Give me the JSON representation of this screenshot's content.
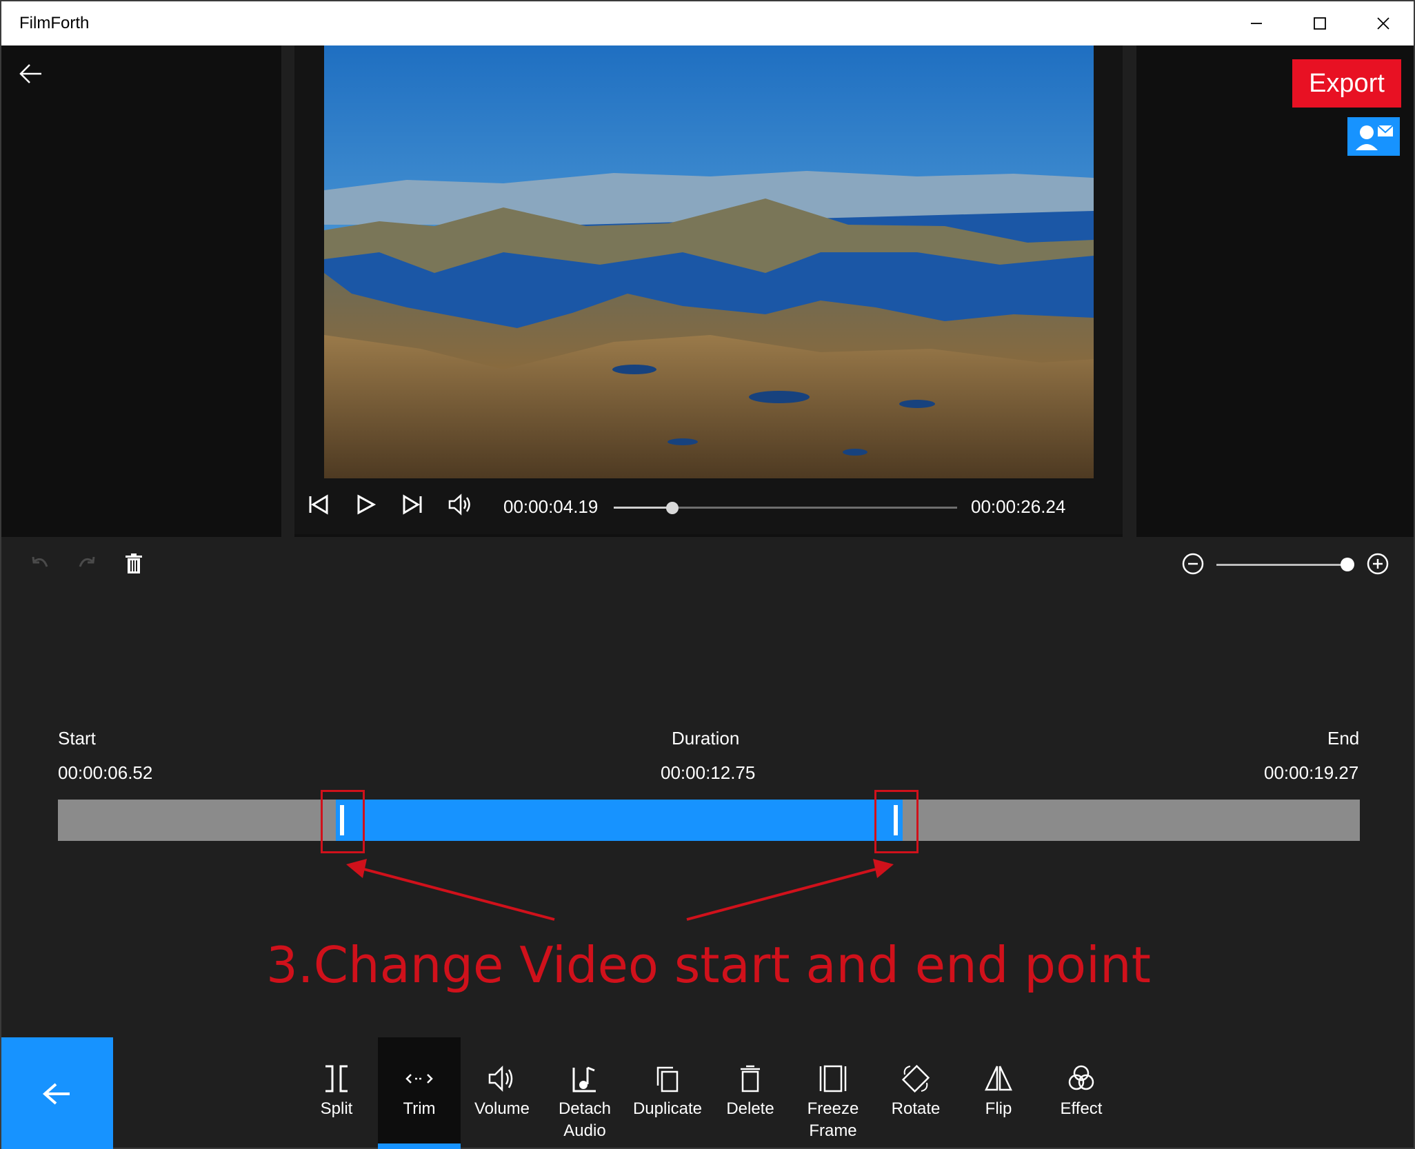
{
  "window": {
    "title": "FilmForth",
    "minimize_icon": "minimize-icon",
    "maximize_icon": "maximize-icon",
    "close_icon": "close-icon"
  },
  "header": {
    "export_label": "Export",
    "export_color": "#e81123",
    "accent_color": "#1793ff"
  },
  "player": {
    "current_time": "00:00:04.19",
    "total_time": "00:00:26.24",
    "seek_progress": 0.16
  },
  "trim": {
    "start_label": "Start",
    "start_value": "00:00:06.52",
    "duration_label": "Duration",
    "duration_value": "00:00:12.75",
    "end_label": "End",
    "end_value": "00:00:19.27"
  },
  "annotation": {
    "text": "3.Change Video start and end point",
    "color": "#d0111b"
  },
  "tools": [
    {
      "label": "Split",
      "icon": "split-icon"
    },
    {
      "label": "Trim",
      "icon": "trim-icon",
      "active": true
    },
    {
      "label": "Volume",
      "icon": "volume-icon"
    },
    {
      "label": "Detach Audio",
      "icon": "detach-audio-icon"
    },
    {
      "label": "Duplicate",
      "icon": "duplicate-icon"
    },
    {
      "label": "Delete",
      "icon": "delete-icon"
    },
    {
      "label": "Freeze Frame",
      "icon": "freeze-frame-icon"
    },
    {
      "label": "Rotate",
      "icon": "rotate-icon"
    },
    {
      "label": "Flip",
      "icon": "flip-icon"
    },
    {
      "label": "Effect",
      "icon": "effect-icon"
    }
  ]
}
